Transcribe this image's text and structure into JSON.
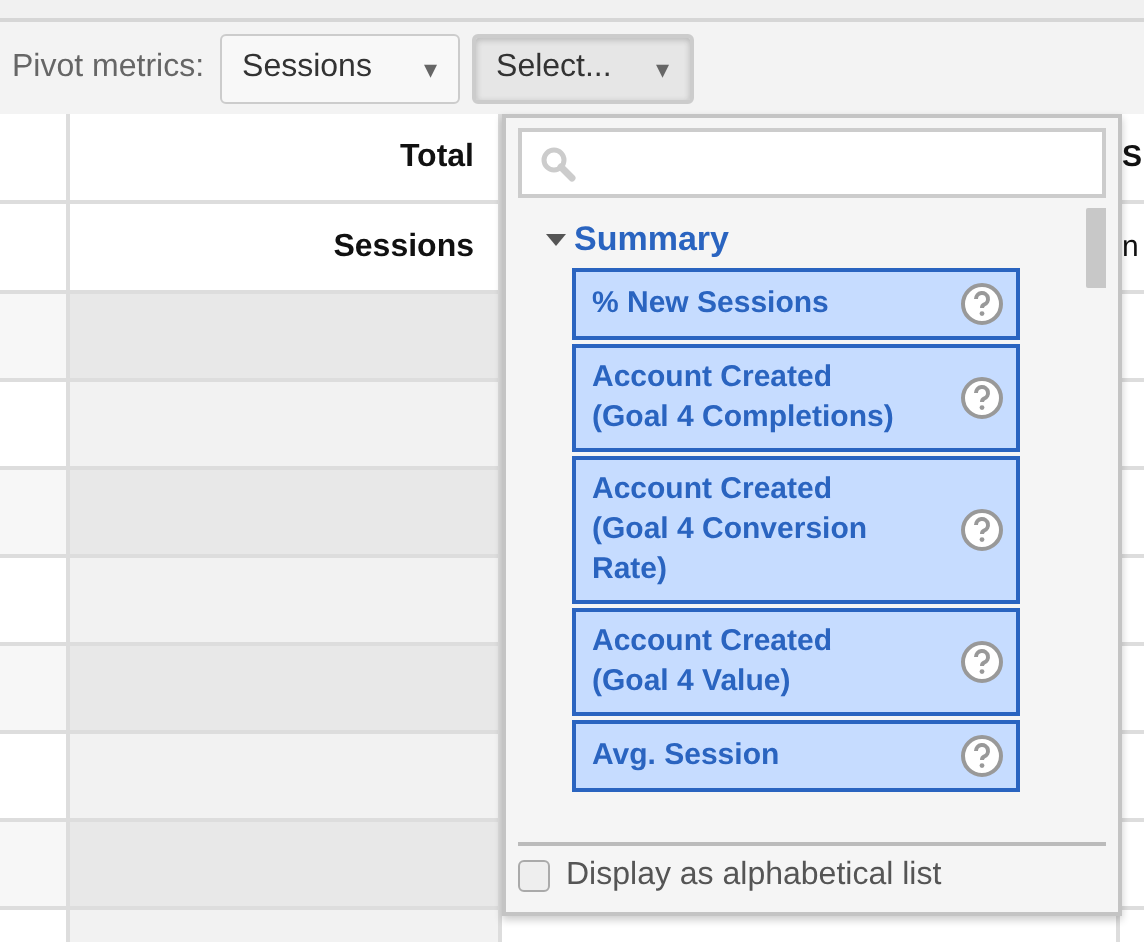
{
  "toolbar": {
    "label": "Pivot metrics:",
    "metric_select": {
      "value": "Sessions",
      "caret": "▾"
    },
    "second_select": {
      "value": "Select...",
      "caret": "▾",
      "expanded": true
    }
  },
  "table": {
    "header_row_1": [
      "Total",
      "S"
    ],
    "header_row_2": [
      "Sessions",
      "n"
    ]
  },
  "dropdown": {
    "tree": [
      {
        "label": "Summary",
        "expanded": true,
        "children": [
          {
            "label": "% New Sessions",
            "selected": true
          },
          {
            "label": "Account Created (Goal 4 Completions)",
            "selected": true
          },
          {
            "label": "Account Created (Goal 4 Conversion Rate)",
            "selected": true
          },
          {
            "label": "Account Created (Goal 4 Value)",
            "selected": true
          },
          {
            "label": "Avg. Session",
            "selected": true
          }
        ]
      }
    ],
    "alphabetical": {
      "label": "Display as alphabetical list",
      "checked": false
    }
  }
}
